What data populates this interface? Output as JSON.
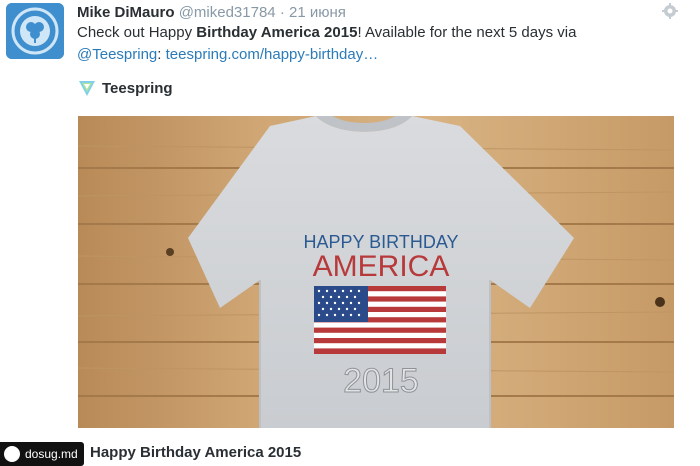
{
  "tweet": {
    "author_name": "Mike DiMauro",
    "handle": "@miked31784",
    "separator": "·",
    "date": "21 июня",
    "text_before": "Check out Happy ",
    "text_bold": "Birthday America 2015",
    "text_after": "! Available for the next 5 days via",
    "mention": "@Teespring",
    "colon": ":",
    "url": "teespring.com/happy-birthday…"
  },
  "card": {
    "brand": "Teespring",
    "shirt_line1": "HAPPY BIRTHDAY",
    "shirt_line2": "AMERICA",
    "shirt_year": "2015",
    "title": "Happy Birthday America 2015"
  },
  "watermark": {
    "text": "dosug.md"
  },
  "icons": {
    "avatar": "clover-badge-icon",
    "settings": "gear-icon",
    "brand": "teespring-logo-icon"
  },
  "colors": {
    "link": "#2b7bb9",
    "muted": "#8899a6",
    "text": "#292f33",
    "shirt_blue": "#2a5a92",
    "shirt_red": "#b8393a",
    "wood": "#c79c6a"
  }
}
